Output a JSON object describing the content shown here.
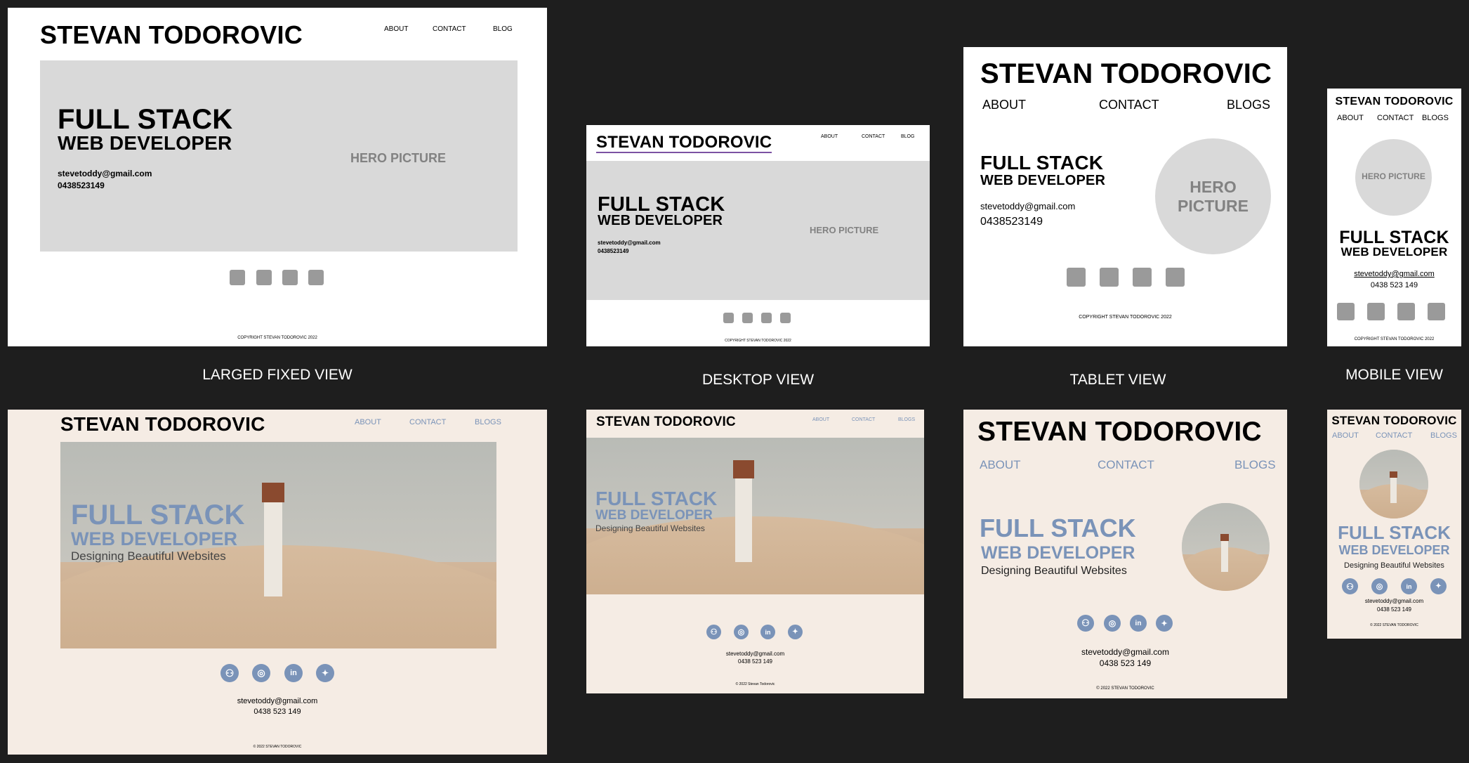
{
  "brand": "STEVAN TODOROVIC",
  "nav": {
    "about": "ABOUT",
    "contact": "CONTACT",
    "blog": "BLOG",
    "blogs": "BLOGS"
  },
  "hero": {
    "line1": "FULL STACK",
    "line2": "WEB DEVELOPER",
    "tagline": "Designing Beautiful Websites",
    "picture_placeholder": "HERO PICTURE",
    "picture_placeholder_line1": "HERO",
    "picture_placeholder_line2": "PICTURE"
  },
  "contact": {
    "email": "stevetoddy@gmail.com",
    "phone_compact": "0438523149",
    "phone_spaced": "0438 523 149"
  },
  "footer": {
    "copyright_upper": "COPYRIGHT STEVAN TODOROVIC 2022",
    "copyright_symbol": "© 2022 STEVAN TODOROVIC",
    "copyright_symbol_mixed": "© 2022 Stevan Todorovic"
  },
  "view_labels": {
    "large_fixed": "LARGED FIXED VIEW",
    "desktop": "DESKTOP VIEW",
    "tablet": "TABLET VIEW",
    "mobile": "MOBILE VIEW"
  },
  "social_icons": [
    "github-icon",
    "instagram-icon",
    "linkedin-icon",
    "twitter-icon"
  ],
  "colors": {
    "canvas": "#1e1e1e",
    "wireframe_bg": "#ffffff",
    "wireframe_block": "#d9d9d9",
    "wireframe_icon": "#9a9a9a",
    "final_bg": "#f5ece4",
    "accent_blue": "#7a93b8"
  }
}
